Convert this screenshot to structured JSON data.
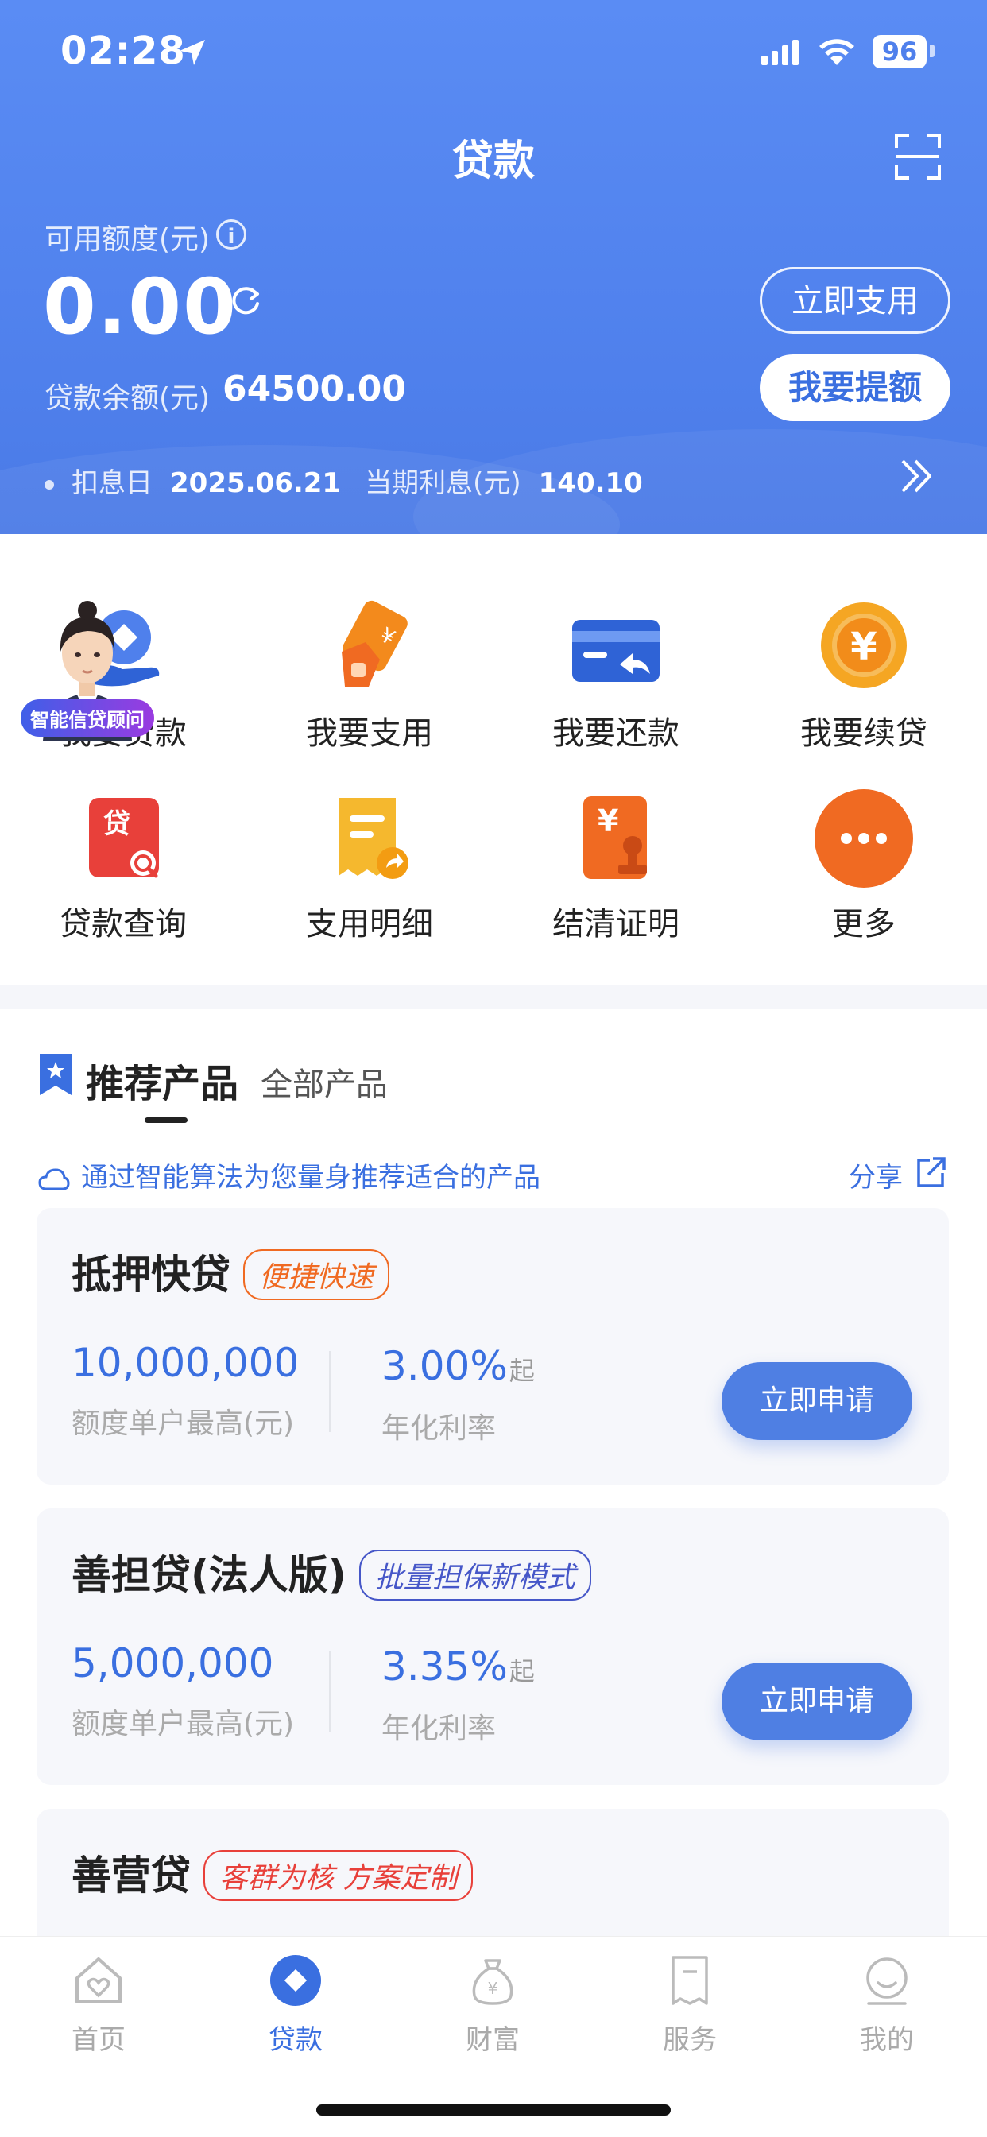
{
  "status_bar": {
    "time": "02:28",
    "battery": "96"
  },
  "header": {
    "title": "贷款",
    "quota_label": "可用额度(元)",
    "quota_value": "0.00",
    "use_button": "立即支用",
    "raise_button": "我要提额",
    "balance_label": "贷款余额(元)",
    "balance_value": "64500.00",
    "interest_date_label": "扣息日",
    "interest_date": "2025.06.21",
    "current_interest_label": "当期利息(元)",
    "current_interest": "140.10"
  },
  "advisor_badge": "智能信贷顾问",
  "actions": [
    {
      "label": "我要贷款",
      "icon": "loan-hand-icon"
    },
    {
      "label": "我要支用",
      "icon": "card-in-hand-icon"
    },
    {
      "label": "我要还款",
      "icon": "card-return-icon"
    },
    {
      "label": "我要续贷",
      "icon": "yen-coin-icon"
    },
    {
      "label": "贷款查询",
      "icon": "loan-search-icon"
    },
    {
      "label": "支用明细",
      "icon": "receipt-share-icon"
    },
    {
      "label": "结清证明",
      "icon": "yen-stamp-icon"
    },
    {
      "label": "更多",
      "icon": "more-icon"
    }
  ],
  "products": {
    "tab_recommended": "推荐产品",
    "tab_all": "全部产品",
    "hint": "通过智能算法为您量身推荐适合的产品",
    "share": "分享",
    "items": [
      {
        "name": "抵押快贷",
        "tag": "便捷快速",
        "amount": "10,000,000",
        "amount_label": "额度单户最高(元)",
        "rate": "3.00%",
        "rate_suffix": "起",
        "rate_label": "年化利率",
        "button": "立即申请"
      },
      {
        "name": "善担贷(法人版)",
        "tag": "批量担保新模式",
        "amount": "5,000,000",
        "amount_label": "额度单户最高(元)",
        "rate": "3.35%",
        "rate_suffix": "起",
        "rate_label": "年化利率",
        "button": "立即申请"
      },
      {
        "name": "善营贷",
        "tag": "客群为核 方案定制"
      }
    ]
  },
  "tabbar": [
    {
      "label": "首页",
      "icon": "home-icon"
    },
    {
      "label": "贷款",
      "icon": "loan-icon",
      "active": true
    },
    {
      "label": "财富",
      "icon": "wealth-icon"
    },
    {
      "label": "服务",
      "icon": "service-icon"
    },
    {
      "label": "我的",
      "icon": "profile-icon"
    }
  ],
  "colors": {
    "primary": "#4f80ec",
    "accent_blue": "#3a6fe0",
    "orange": "#f06a22",
    "red": "#e8403a"
  }
}
